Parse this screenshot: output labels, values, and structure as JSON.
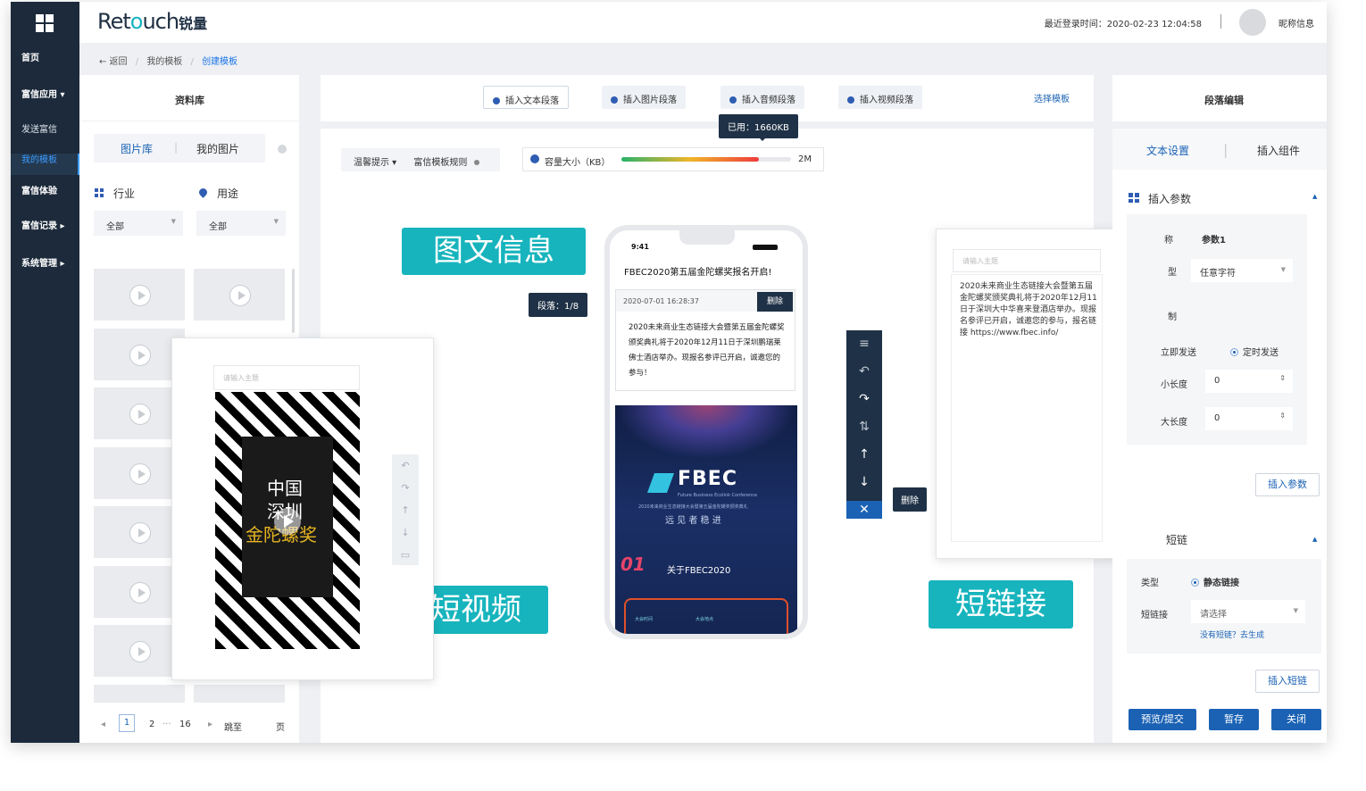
{
  "sidebar": {
    "items": [
      {
        "label": "首页"
      },
      {
        "label": "富信应用 ▾"
      },
      {
        "label": "发送富信"
      },
      {
        "label": "我的模板"
      },
      {
        "label": "富信体验"
      },
      {
        "label": "富信记录 ▸"
      },
      {
        "label": "系统管理 ▸"
      }
    ]
  },
  "header": {
    "logo_main_a": "Ret",
    "logo_main_o": "o",
    "logo_main_b": "uch",
    "logo_cn": "锐量",
    "last_login": "最近登录时间：2020-02-23 12:04:58",
    "nickname": "昵称信息"
  },
  "breadcrumb": {
    "back": "← 返回",
    "parent": "我的模板",
    "sep": "/",
    "current": "创建模板"
  },
  "library": {
    "title": "资料库",
    "tabs": [
      "图片库",
      "我的图片"
    ],
    "filter_industry_label": "行业",
    "filter_usage_label": "用途",
    "industry_value": "全部",
    "usage_value": "全部",
    "pagination": [
      "◂",
      "1",
      "2",
      "···",
      "16",
      "▸",
      "跳至",
      "页"
    ]
  },
  "toolbar": {
    "insert_text": "插入文本段落",
    "insert_image": "插入图片段落",
    "insert_audio": "插入音频段落",
    "insert_video": "插入视频段落",
    "choose_template": "选择模板",
    "used_tooltip": "已用：1660KB",
    "hint": "温馨提示 ▾",
    "rules": "富信模板规则",
    "capacity_label": "容量大小（KB）",
    "capacity_max": "2M",
    "capacity_fraction": 0.81
  },
  "tags": {
    "image_text": "图文信息",
    "short_video": "短视频",
    "short_link": "短链接"
  },
  "video_card": {
    "placeholder": "请输入主题",
    "poster_line1": "中国",
    "poster_line2": "深圳",
    "poster_line3": "金陀螺奖"
  },
  "phone": {
    "time": "9:41",
    "title": "FBEC2020第五届金陀螺奖报名开启!",
    "segment": "段落：1/8",
    "timestamp": "2020-07-01 16:28:37",
    "delete": "删除",
    "body": "2020未来商业生态链接大会暨第五届金陀螺奖颁奖典礼将于2020年12月11日于深圳鹏瑞莱佛士酒店举办。现报名参评已开启，诚邀您的参与！",
    "banner_brand": "FBEC",
    "banner_sub": "Future Business Ecolink Conference",
    "banner_line": "2020未来商业生态链接大会暨第五届金陀螺奖颁奖典礼",
    "banner_slogan": "远 见 者 稳 进",
    "section_no": "01",
    "section_title": "关于FBEC2020",
    "footer_a": "大会时间",
    "footer_b": "大会地点"
  },
  "vtool": {
    "delete": "删除"
  },
  "link_card": {
    "placeholder": "请输入主题",
    "body": "2020未来商业生态链接大会暨第五届金陀螺奖颁奖典礼将于2020年12月11日于深圳大中华喜来登酒店举办。现报名参评已开启，诚邀您的参与，报名链接 https://www.fbec.info/"
  },
  "editor": {
    "title": "段落编辑",
    "tab_text": "文本设置",
    "tab_component": "插入组件",
    "section_param": "插入参数",
    "name_label": "称",
    "name_value": "参数1",
    "type_label": "型",
    "type_value": "任意字符",
    "limit_label": "制",
    "radio_now": "立即发送",
    "radio_timed": "定时发送",
    "min_label": "小长度",
    "min_value": "0",
    "max_label": "大长度",
    "max_value": "0",
    "insert_param": "插入参数",
    "section_link": "短链",
    "link_type_label": "类型",
    "link_type_value": "静态链接",
    "link_label": "短链接",
    "link_placeholder": "请选择",
    "no_link": "没有短链？去生成",
    "insert_link": "插入短链",
    "btn_preview": "预览/提交",
    "btn_save": "暂存",
    "btn_close": "关闭"
  }
}
